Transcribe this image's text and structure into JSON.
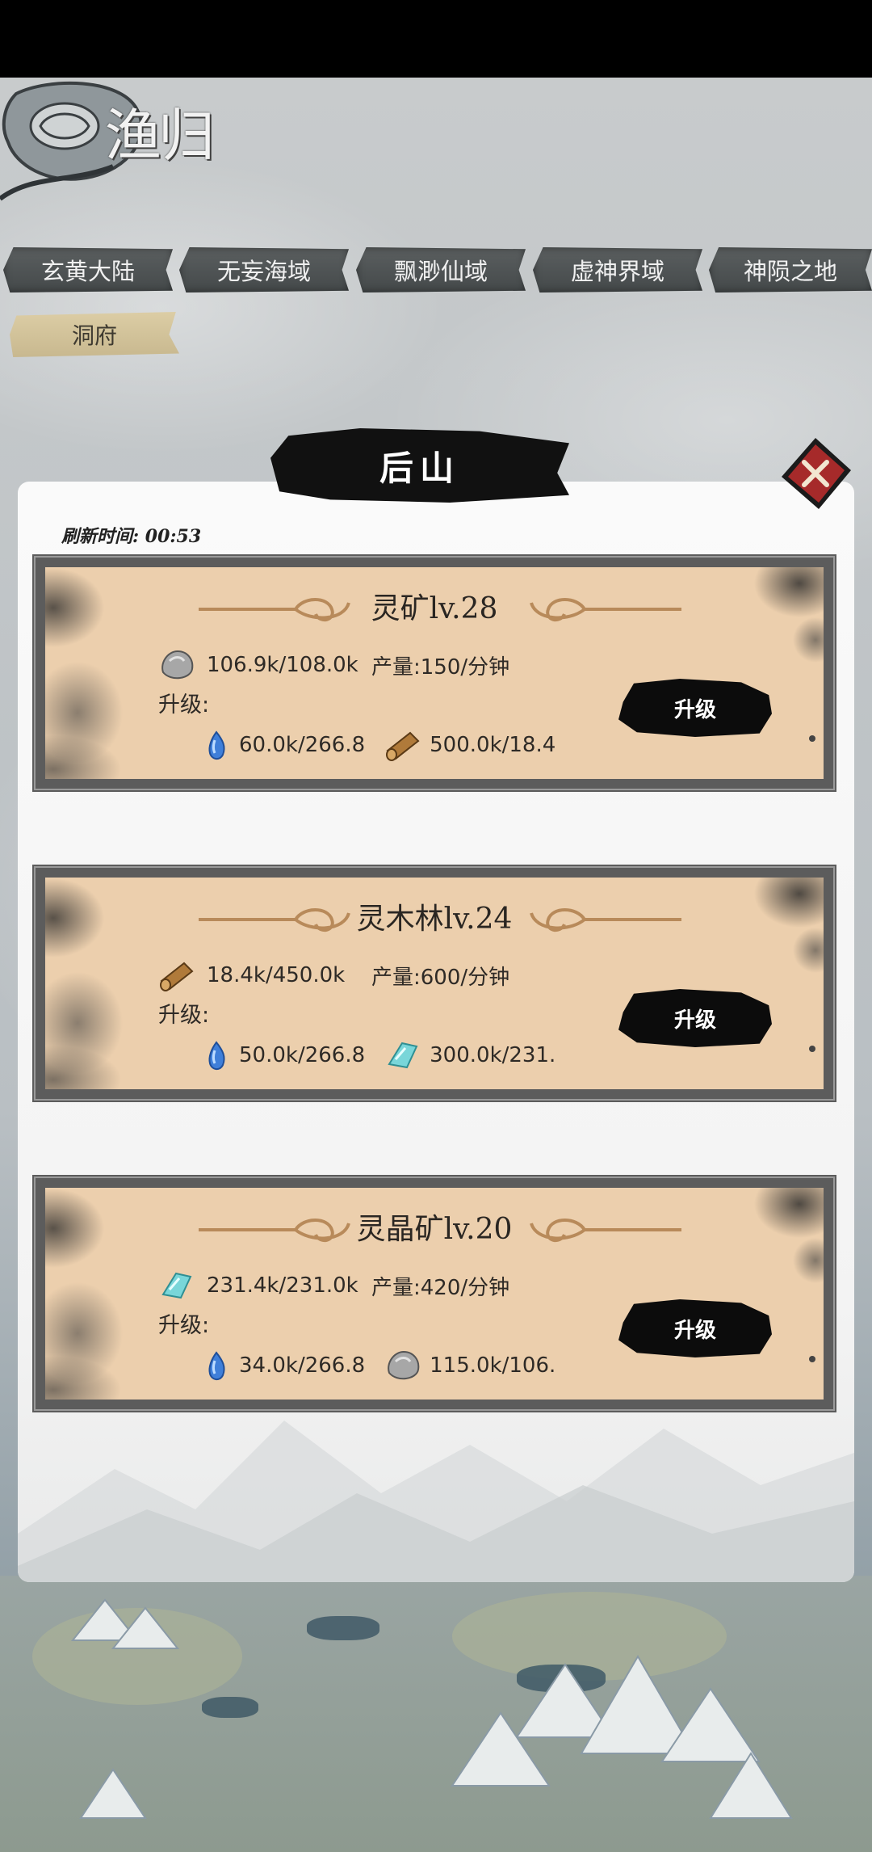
{
  "logo": {
    "text": "渔归"
  },
  "regions": [
    {
      "label": "玄黄大陆"
    },
    {
      "label": "无妄海域"
    },
    {
      "label": "飘渺仙域"
    },
    {
      "label": "虚神界域"
    },
    {
      "label": "神陨之地"
    }
  ],
  "subtab": {
    "label": "洞府"
  },
  "panel": {
    "title": "后山",
    "refresh_time": "刷新时间: 00:53"
  },
  "buildings": [
    {
      "name": "灵矿lv.28",
      "resource_icon": "stone-icon",
      "amount": "106.9k/108.0k",
      "output": "产量:150/分钟",
      "upgrade_label": "升级:",
      "costs": [
        {
          "icon": "blue-gem-icon",
          "value": "60.0k/266.8"
        },
        {
          "icon": "wood-log-icon",
          "value": "500.0k/18.4"
        }
      ],
      "button_label": "升级"
    },
    {
      "name": "灵木林lv.24",
      "resource_icon": "wood-log-icon",
      "amount": "18.4k/450.0k",
      "output": "产量:600/分钟",
      "upgrade_label": "升级:",
      "costs": [
        {
          "icon": "blue-gem-icon",
          "value": "50.0k/266.8"
        },
        {
          "icon": "crystal-icon",
          "value": "300.0k/231."
        }
      ],
      "button_label": "升级"
    },
    {
      "name": "灵晶矿lv.20",
      "resource_icon": "crystal-icon",
      "amount": "231.4k/231.0k",
      "output": "产量:420/分钟",
      "upgrade_label": "升级:",
      "costs": [
        {
          "icon": "blue-gem-icon",
          "value": "34.0k/266.8"
        },
        {
          "icon": "stone-icon",
          "value": "115.0k/106."
        }
      ],
      "button_label": "升级"
    }
  ],
  "colors": {
    "card_bg": "#eccfad",
    "frame": "#5c5c5c",
    "button": "#0c0c0c",
    "tab_bg": "#4e5354",
    "subtab_bg": "#d4c49b"
  }
}
